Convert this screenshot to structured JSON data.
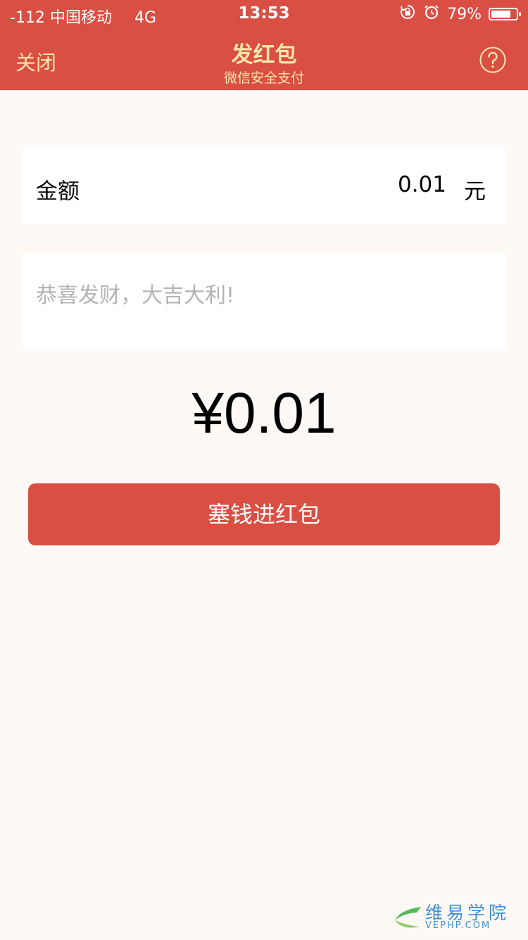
{
  "status_bar": {
    "signal": "-112",
    "carrier": "中国移动",
    "network": "4G",
    "time": "13:53",
    "battery_text": "79%",
    "battery_level": 0.79
  },
  "nav": {
    "close_label": "关闭",
    "title": "发红包",
    "subtitle": "微信安全支付"
  },
  "form": {
    "amount_label": "金额",
    "amount_value": "0.01",
    "amount_unit": "元",
    "message_placeholder": "恭喜发财，大吉大利!"
  },
  "total": "¥0.01",
  "submit_label": "塞钱进红包",
  "watermark": {
    "name": "维易学院",
    "domain": "VEPHP.COM"
  },
  "colors": {
    "brand_red": "#d94f43",
    "nav_text": "#fde6a7",
    "page_bg": "#fff9f5"
  }
}
